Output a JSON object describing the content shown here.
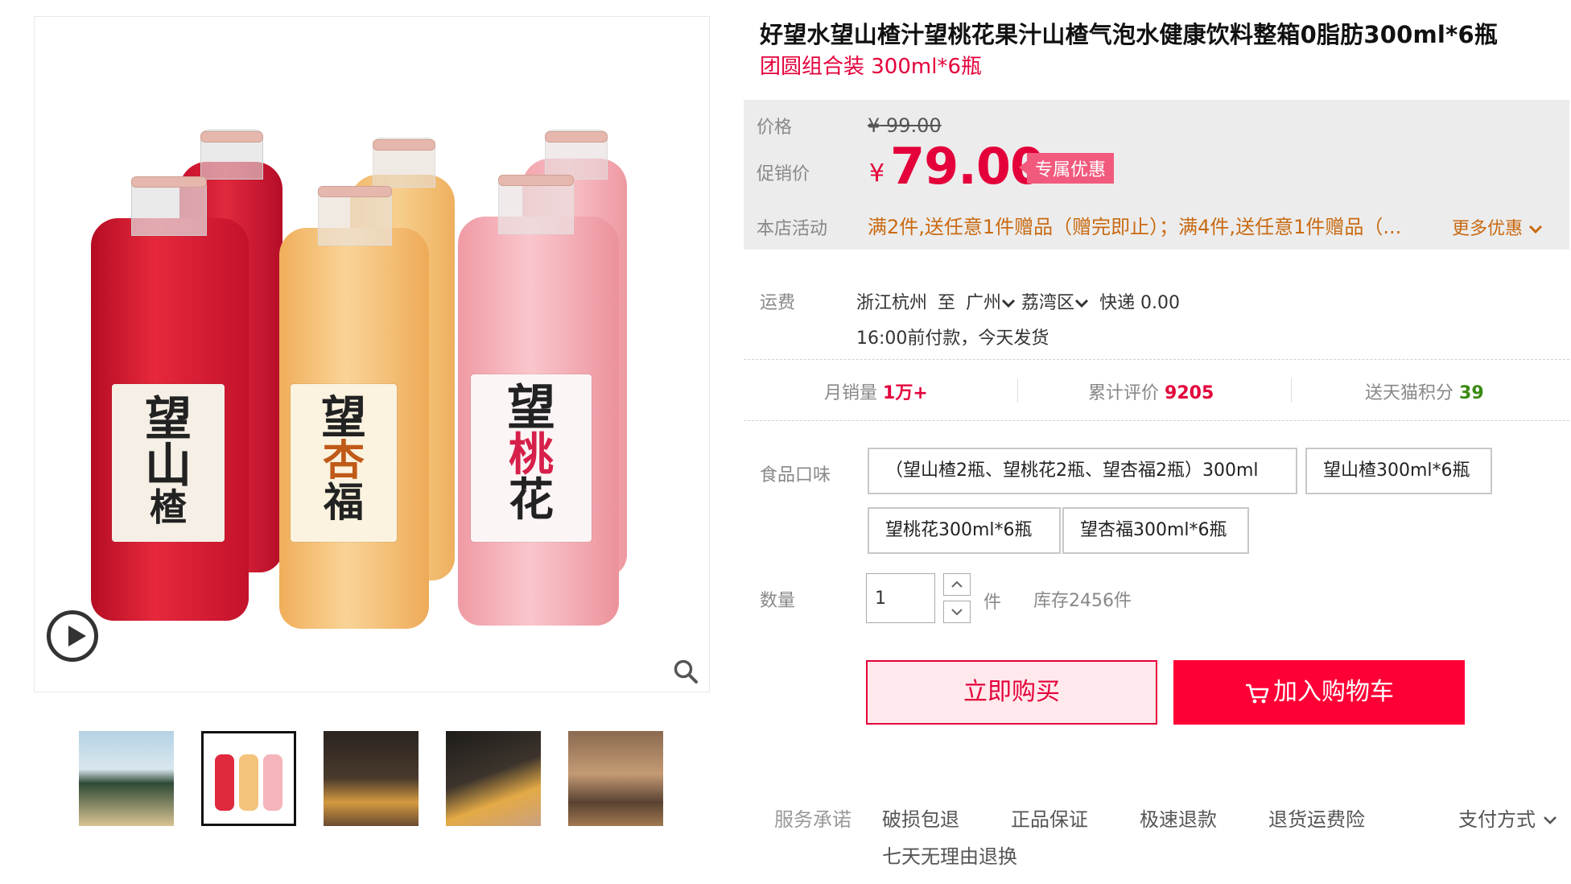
{
  "product": {
    "title": "好望水望山楂汁望桃花果汁山楂气泡水健康饮料整箱0脂肪300ml*6瓶",
    "subtitle": "团圆组合装 300ml*6瓶"
  },
  "gallery": {
    "bottle_labels": [
      [
        "望",
        "山",
        "楂"
      ],
      [
        "望",
        "杏",
        "福"
      ],
      [
        "望",
        "桃",
        "花"
      ]
    ],
    "thumbnails": [
      {
        "name": "thumb-1",
        "colors": [
          "#9cc0d6",
          "#e2a84a"
        ]
      },
      {
        "name": "thumb-2",
        "colors": [
          "#e04a56",
          "#f4c07a"
        ]
      },
      {
        "name": "thumb-3",
        "colors": [
          "#4a3a2e",
          "#d8a84e"
        ]
      },
      {
        "name": "thumb-4",
        "colors": [
          "#2e2a26",
          "#e6b24a"
        ]
      },
      {
        "name": "thumb-5",
        "colors": [
          "#7a5a40",
          "#d8b088"
        ]
      }
    ]
  },
  "price": {
    "price_label": "价格",
    "original": "99.00",
    "original_currency": "¥",
    "promo_label": "促销价",
    "currency": "¥",
    "promo": "79.00",
    "badge": "专属优惠",
    "activity_label": "本店活动",
    "activity": "满2件,送任意1件赠品（赠完即止）；满4件,送任意1件赠品（...",
    "more": "更多优惠"
  },
  "shipping": {
    "label": "运费",
    "from": "浙江杭州",
    "to_word": "至",
    "city": "广州",
    "district": "荔湾区",
    "method": "快递 0.00",
    "note": "16:00前付款，今天发货"
  },
  "stats": {
    "monthly_label": "月销量",
    "monthly_value": "1万+",
    "reviews_label": "累计评价",
    "reviews_value": "9205",
    "points_label": "送天猫积分",
    "points_value": "39"
  },
  "flavor": {
    "label": "食品口味",
    "options": [
      "（望山楂2瓶、望桃花2瓶、望杏福2瓶）300ml",
      "望山楂300ml*6瓶",
      "望桃花300ml*6瓶",
      "望杏福300ml*6瓶"
    ]
  },
  "quantity": {
    "label": "数量",
    "value": "1",
    "unit": "件",
    "stock": "库存2456件"
  },
  "actions": {
    "buy_now": "立即购买",
    "add_to_cart": "加入购物车"
  },
  "services": {
    "label": "服务承诺",
    "items": [
      "破损包退",
      "正品保证",
      "极速退款",
      "退货运费险"
    ],
    "line2": "七天无理由退换",
    "payment": "支付方式"
  },
  "colors": {
    "accent": "#ff0036",
    "price_red": "#e4003a",
    "activity_orange": "#c96a12",
    "points_green": "#3a8a12"
  }
}
